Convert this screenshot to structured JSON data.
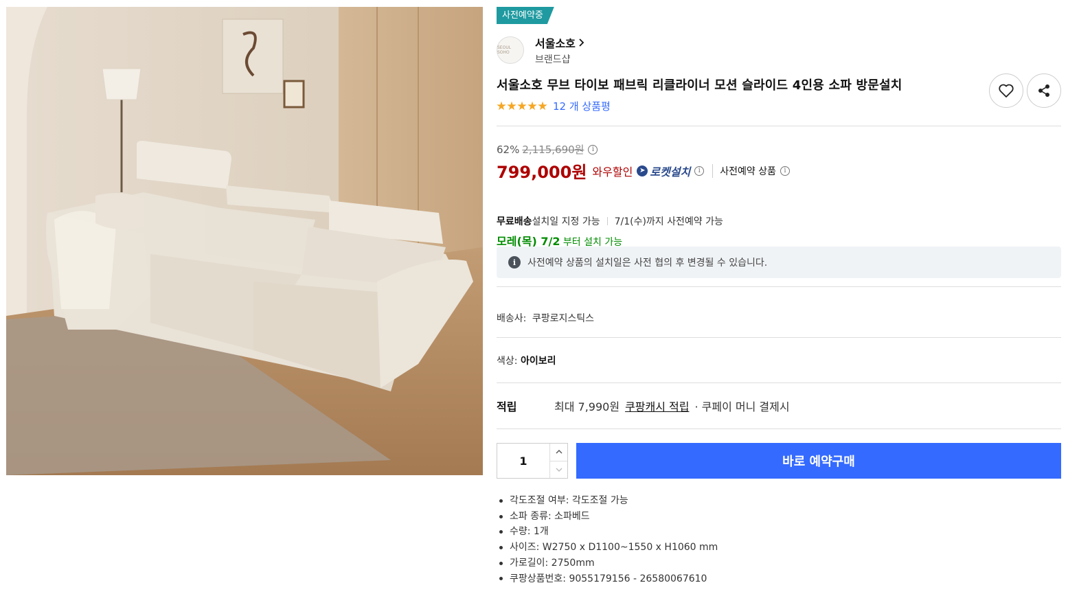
{
  "product_image": {
    "alt": "sofa-photo"
  },
  "badge": "사전예약중",
  "brand": {
    "logo_text": "SEOUL SOHO",
    "name": "서울소호",
    "sub": "브랜드샵"
  },
  "title": "서울소호 무브 타이보 패브릭 리클라이너 모션 슬라이드 4인용 소파 방문설치",
  "rating": {
    "stars": 5,
    "count_text": "12 개 상품평"
  },
  "price": {
    "discount": "62%",
    "original": "2,115,690원",
    "sale": "799,000원",
    "wow_label": "와우할인",
    "rocket_label": "로켓설치",
    "preorder_label": "사전예약 상품"
  },
  "shipping": {
    "free": "무료배송",
    "install_select": "설치일 지정 가능",
    "preorder_until": "7/1(수)까지 사전예약 가능",
    "arrival_date": "모레(목) 7/2",
    "arrival_suffix": " 부터 설치 가능"
  },
  "notice": "사전예약 상품의 설치일은 사전 협의 후 변경될 수 있습니다.",
  "carrier": {
    "label": "배송사:",
    "value": "쿠팡로지스틱스"
  },
  "color": {
    "label": "색상:",
    "value": "아이보리"
  },
  "reward": {
    "label": "적립",
    "max": "최대 7,990원",
    "link": "쿠팡캐시 적립",
    "suffix": "· 쿠페이 머니 결제시"
  },
  "quantity": "1",
  "buy_button": "바로 예약구매",
  "specs": [
    "각도조절 여부: 각도조절 가능",
    "소파 종류: 소파베드",
    "수량: 1개",
    "사이즈: W2750 x D1100~1550 x H1060 mm",
    "가로길이: 2750mm",
    "쿠팡상품번호: 9055179156 - 26580067610"
  ],
  "colors": {
    "accent": "#346aff",
    "sale": "#ae0000",
    "arrival": "#008c00",
    "badge": "#1e9aa0"
  }
}
